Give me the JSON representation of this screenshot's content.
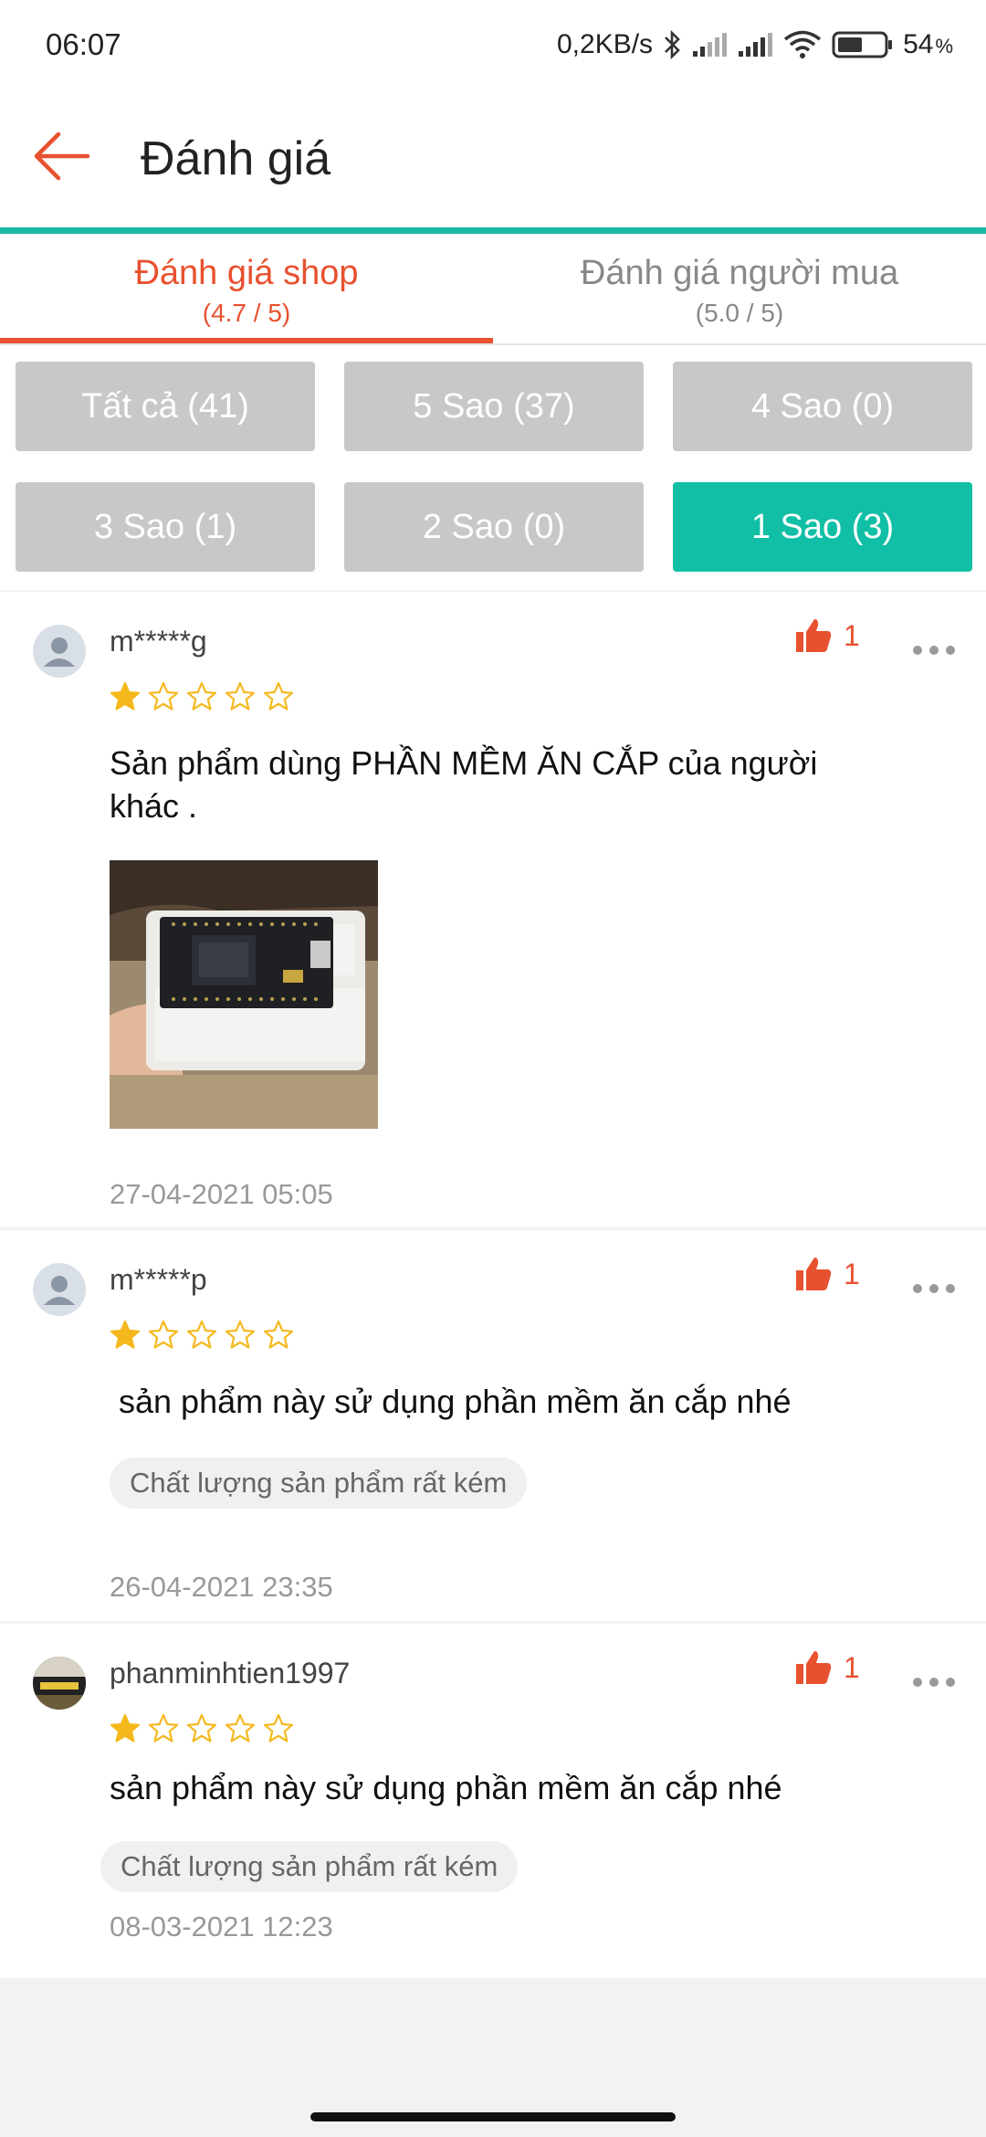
{
  "status": {
    "time": "06:07",
    "net_speed": "0,2KB/s",
    "battery": "54",
    "battery_unit": "%"
  },
  "header": {
    "title": "Đánh giá"
  },
  "tabs": [
    {
      "label": "Đánh giá shop",
      "sub": "(4.7 / 5)"
    },
    {
      "label": "Đánh giá người mua",
      "sub": "(5.0 / 5)"
    }
  ],
  "filters": [
    {
      "label": "Tất cả (41)"
    },
    {
      "label": "5 Sao (37)"
    },
    {
      "label": "4 Sao (0)"
    },
    {
      "label": "3 Sao (1)"
    },
    {
      "label": "2 Sao (0)"
    },
    {
      "label": "1 Sao (3)"
    }
  ],
  "reviews": [
    {
      "user": "m*****g",
      "likes": "1",
      "rating": 1,
      "text": "Sản phẩm dùng PHẦN MỀM ĂN CẮP của người khác .",
      "date": "27-04-2021 05:05"
    },
    {
      "user": "m*****p",
      "likes": "1",
      "rating": 1,
      "text": " sản phẩm này sử dụng phần mềm ăn cắp nhé",
      "tag": "Chất lượng sản phẩm rất kém",
      "date": "26-04-2021 23:35"
    },
    {
      "user": "phanminhtien1997",
      "likes": "1",
      "rating": 1,
      "text": "sản phẩm này sử dụng phần mềm ăn cắp nhé",
      "tag": "Chất lượng sản phẩm rất kém",
      "date": "08-03-2021 12:23"
    }
  ],
  "colors": {
    "accent": "#e8512f",
    "teal": "#10bfa5",
    "star": "#f5b81c"
  },
  "icons": {
    "back": "arrow-left-icon",
    "like": "thumbs-up-icon",
    "more": "more-dots-icon",
    "star": "star-icon",
    "avatar": "person-icon"
  }
}
